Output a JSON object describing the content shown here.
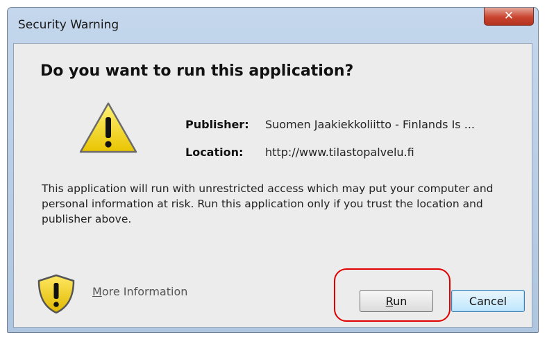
{
  "window": {
    "title": "Security Warning",
    "close_glyph": "✕"
  },
  "dialog": {
    "heading": "Do you want to run this application?",
    "publisher_label": "Publisher:",
    "publisher_value": "Suomen Jaakiekkoliitto - Finlands Is ...",
    "location_label": "Location:",
    "location_value": "http://www.tilastopalvelu.fi",
    "message": "This application will run with unrestricted access which may put your computer and personal information at risk. Run this application only if you trust the location and publisher above."
  },
  "footer": {
    "more_info_first": "M",
    "more_info_rest": "ore Information",
    "run_first": "R",
    "run_rest": "un",
    "cancel_label": "Cancel"
  },
  "icons": {
    "warning": "warning-triangle-icon",
    "shield": "security-shield-icon",
    "close": "close-icon"
  },
  "colors": {
    "highlight": "#e00000",
    "warning_yellow": "#f5d800",
    "close_red": "#c9442f"
  }
}
